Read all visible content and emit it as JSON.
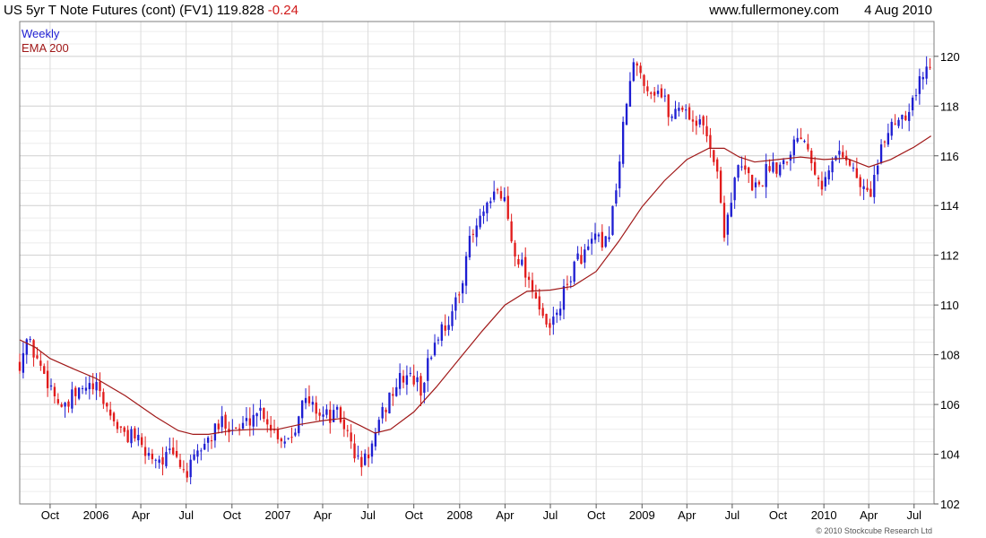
{
  "header": {
    "instrument": "US 5yr T Note Futures (cont) (FV1)",
    "price": "119.828",
    "change": "-0.24",
    "website": "www.fullermoney.com",
    "date": "4 Aug 2010"
  },
  "legend": {
    "interval": "Weekly",
    "ema": "EMA 200"
  },
  "copyright": "© 2010 Stockcube Research Ltd",
  "colors": {
    "up": "#1e1ed2",
    "down": "#e11b1b",
    "ema": "#a01818",
    "grid": "#d4d4d4",
    "frame": "#7f7f7f",
    "change": "#d11a1a"
  },
  "chart_data": {
    "type": "candlestick",
    "interval": "Weekly",
    "grid": true,
    "ylim": [
      102,
      121.4
    ],
    "xlim": [
      "2005-08-01",
      "2010-08-10"
    ],
    "yticks": [
      102,
      104,
      106,
      108,
      110,
      112,
      114,
      116,
      118,
      120
    ],
    "xticks": [
      {
        "label": "Oct",
        "date": "2005-10-01"
      },
      {
        "label": "2006",
        "date": "2006-01-01"
      },
      {
        "label": "Apr",
        "date": "2006-04-01"
      },
      {
        "label": "Jul",
        "date": "2006-07-01"
      },
      {
        "label": "Oct",
        "date": "2006-10-01"
      },
      {
        "label": "2007",
        "date": "2007-01-01"
      },
      {
        "label": "Apr",
        "date": "2007-04-01"
      },
      {
        "label": "Jul",
        "date": "2007-07-01"
      },
      {
        "label": "Oct",
        "date": "2007-10-01"
      },
      {
        "label": "2008",
        "date": "2008-01-01"
      },
      {
        "label": "Apr",
        "date": "2008-04-01"
      },
      {
        "label": "Jul",
        "date": "2008-07-01"
      },
      {
        "label": "Oct",
        "date": "2008-10-01"
      },
      {
        "label": "2009",
        "date": "2009-01-01"
      },
      {
        "label": "Apr",
        "date": "2009-04-01"
      },
      {
        "label": "Jul",
        "date": "2009-07-01"
      },
      {
        "label": "Oct",
        "date": "2009-10-01"
      },
      {
        "label": "2010",
        "date": "2010-01-01"
      },
      {
        "label": "Apr",
        "date": "2010-04-01"
      },
      {
        "label": "Jul",
        "date": "2010-07-01"
      }
    ],
    "price_path": [
      [
        "2005-08-01",
        107.7
      ],
      [
        "2005-08-15",
        108.6
      ],
      [
        "2005-09-01",
        108.0
      ],
      [
        "2005-09-15",
        107.4
      ],
      [
        "2005-10-01",
        106.8
      ],
      [
        "2005-10-15",
        106.2
      ],
      [
        "2005-11-01",
        105.7
      ],
      [
        "2005-11-15",
        106.3
      ],
      [
        "2005-12-01",
        106.5
      ],
      [
        "2005-12-15",
        106.7
      ],
      [
        "2006-01-01",
        106.6
      ],
      [
        "2006-01-15",
        106.2
      ],
      [
        "2006-02-01",
        105.5
      ],
      [
        "2006-02-15",
        105.1
      ],
      [
        "2006-03-01",
        104.6
      ],
      [
        "2006-03-15",
        105.0
      ],
      [
        "2006-04-01",
        104.2
      ],
      [
        "2006-04-15",
        104.0
      ],
      [
        "2006-05-01",
        103.9
      ],
      [
        "2006-05-15",
        103.8
      ],
      [
        "2006-06-01",
        104.0
      ],
      [
        "2006-06-15",
        103.7
      ],
      [
        "2006-07-01",
        103.2
      ],
      [
        "2006-07-15",
        103.6
      ],
      [
        "2006-08-01",
        104.3
      ],
      [
        "2006-08-15",
        104.6
      ],
      [
        "2006-09-01",
        105.0
      ],
      [
        "2006-09-15",
        105.4
      ],
      [
        "2006-10-01",
        105.1
      ],
      [
        "2006-10-15",
        105.0
      ],
      [
        "2006-11-01",
        105.3
      ],
      [
        "2006-11-15",
        105.7
      ],
      [
        "2006-12-01",
        105.8
      ],
      [
        "2006-12-15",
        105.2
      ],
      [
        "2007-01-01",
        104.8
      ],
      [
        "2007-01-15",
        104.6
      ],
      [
        "2007-02-01",
        104.9
      ],
      [
        "2007-02-15",
        106.0
      ],
      [
        "2007-03-01",
        106.1
      ],
      [
        "2007-03-15",
        105.9
      ],
      [
        "2007-04-01",
        105.6
      ],
      [
        "2007-04-15",
        105.5
      ],
      [
        "2007-05-01",
        105.6
      ],
      [
        "2007-05-15",
        105.1
      ],
      [
        "2007-06-01",
        104.2
      ],
      [
        "2007-06-15",
        103.5
      ],
      [
        "2007-07-01",
        104.0
      ],
      [
        "2007-07-15",
        104.6
      ],
      [
        "2007-08-01",
        105.7
      ],
      [
        "2007-08-15",
        106.4
      ],
      [
        "2007-09-01",
        106.9
      ],
      [
        "2007-09-15",
        107.2
      ],
      [
        "2007-10-01",
        107.0
      ],
      [
        "2007-10-15",
        106.6
      ],
      [
        "2007-11-01",
        107.8
      ],
      [
        "2007-11-15",
        108.7
      ],
      [
        "2007-12-01",
        109.2
      ],
      [
        "2007-12-15",
        109.5
      ],
      [
        "2008-01-01",
        110.5
      ],
      [
        "2008-01-15",
        112.2
      ],
      [
        "2008-02-01",
        113.0
      ],
      [
        "2008-02-15",
        113.6
      ],
      [
        "2008-03-01",
        113.9
      ],
      [
        "2008-03-15",
        114.6
      ],
      [
        "2008-04-01",
        114.2
      ],
      [
        "2008-04-15",
        112.5
      ],
      [
        "2008-05-01",
        111.8
      ],
      [
        "2008-05-15",
        111.2
      ],
      [
        "2008-06-01",
        110.5
      ],
      [
        "2008-06-15",
        109.3
      ],
      [
        "2008-07-01",
        109.0
      ],
      [
        "2008-07-15",
        109.8
      ],
      [
        "2008-08-01",
        110.6
      ],
      [
        "2008-08-15",
        111.5
      ],
      [
        "2008-09-01",
        112.0
      ],
      [
        "2008-09-15",
        112.2
      ],
      [
        "2008-10-01",
        112.8
      ],
      [
        "2008-10-15",
        112.0
      ],
      [
        "2008-11-01",
        113.5
      ],
      [
        "2008-11-15",
        115.5
      ],
      [
        "2008-12-01",
        118.2
      ],
      [
        "2008-12-15",
        119.6
      ],
      [
        "2009-01-01",
        119.3
      ],
      [
        "2009-01-15",
        118.6
      ],
      [
        "2009-02-01",
        118.7
      ],
      [
        "2009-02-15",
        118.2
      ],
      [
        "2009-03-01",
        117.5
      ],
      [
        "2009-03-15",
        118.1
      ],
      [
        "2009-04-01",
        117.8
      ],
      [
        "2009-04-15",
        117.4
      ],
      [
        "2009-05-01",
        117.2
      ],
      [
        "2009-05-15",
        116.8
      ],
      [
        "2009-06-01",
        115.2
      ],
      [
        "2009-06-15",
        113.0
      ],
      [
        "2009-07-01",
        114.5
      ],
      [
        "2009-07-15",
        115.6
      ],
      [
        "2009-08-01",
        115.2
      ],
      [
        "2009-08-15",
        114.7
      ],
      [
        "2009-09-01",
        115.1
      ],
      [
        "2009-09-15",
        115.7
      ],
      [
        "2009-10-01",
        115.6
      ],
      [
        "2009-10-15",
        115.9
      ],
      [
        "2009-11-01",
        116.5
      ],
      [
        "2009-11-15",
        117.0
      ],
      [
        "2009-12-01",
        116.4
      ],
      [
        "2009-12-15",
        115.5
      ],
      [
        "2010-01-01",
        114.8
      ],
      [
        "2010-01-15",
        115.6
      ],
      [
        "2010-02-01",
        116.2
      ],
      [
        "2010-02-15",
        116.0
      ],
      [
        "2010-03-01",
        115.4
      ],
      [
        "2010-03-15",
        114.8
      ],
      [
        "2010-04-01",
        114.4
      ],
      [
        "2010-04-15",
        115.3
      ],
      [
        "2010-05-01",
        116.5
      ],
      [
        "2010-05-15",
        117.3
      ],
      [
        "2010-06-01",
        117.6
      ],
      [
        "2010-06-15",
        117.8
      ],
      [
        "2010-07-01",
        118.4
      ],
      [
        "2010-07-15",
        119.1
      ],
      [
        "2010-08-04",
        119.83
      ]
    ],
    "ema_200": [
      [
        "2005-08-01",
        108.6
      ],
      [
        "2005-09-01",
        108.3
      ],
      [
        "2005-10-01",
        107.85
      ],
      [
        "2005-11-15",
        107.45
      ],
      [
        "2006-01-01",
        107.05
      ],
      [
        "2006-03-01",
        106.35
      ],
      [
        "2006-05-01",
        105.5
      ],
      [
        "2006-06-15",
        104.95
      ],
      [
        "2006-07-15",
        104.8
      ],
      [
        "2006-08-15",
        104.8
      ],
      [
        "2006-10-01",
        104.95
      ],
      [
        "2006-11-15",
        105.0
      ],
      [
        "2007-01-01",
        105.0
      ],
      [
        "2007-02-15",
        105.2
      ],
      [
        "2007-04-01",
        105.35
      ],
      [
        "2007-05-15",
        105.45
      ],
      [
        "2007-06-15",
        105.15
      ],
      [
        "2007-07-15",
        104.85
      ],
      [
        "2007-08-15",
        105.0
      ],
      [
        "2007-10-01",
        105.7
      ],
      [
        "2007-11-15",
        106.7
      ],
      [
        "2008-01-01",
        107.85
      ],
      [
        "2008-02-15",
        108.95
      ],
      [
        "2008-04-01",
        110.0
      ],
      [
        "2008-05-15",
        110.55
      ],
      [
        "2008-07-01",
        110.6
      ],
      [
        "2008-08-15",
        110.75
      ],
      [
        "2008-10-01",
        111.35
      ],
      [
        "2008-11-15",
        112.55
      ],
      [
        "2009-01-01",
        113.95
      ],
      [
        "2009-02-15",
        115.0
      ],
      [
        "2009-04-01",
        115.85
      ],
      [
        "2009-05-15",
        116.3
      ],
      [
        "2009-06-15",
        116.3
      ],
      [
        "2009-07-15",
        115.95
      ],
      [
        "2009-08-15",
        115.75
      ],
      [
        "2009-10-01",
        115.85
      ],
      [
        "2009-11-15",
        115.95
      ],
      [
        "2010-01-01",
        115.85
      ],
      [
        "2010-02-15",
        115.9
      ],
      [
        "2010-04-01",
        115.55
      ],
      [
        "2010-05-15",
        115.85
      ],
      [
        "2010-07-01",
        116.35
      ],
      [
        "2010-08-04",
        116.8
      ]
    ]
  }
}
